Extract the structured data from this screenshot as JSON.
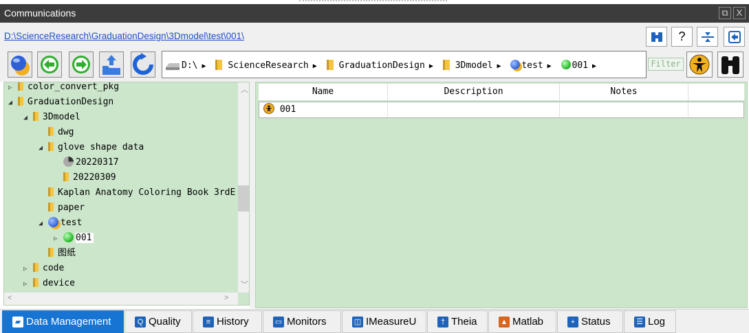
{
  "window": {
    "title": "Communications",
    "restore_glyph": "⧉",
    "close_glyph": "X"
  },
  "pathbar": {
    "path": "D:\\ScienceResearch\\GraduationDesign\\3Dmodel\\test\\001\\",
    "help_label": "?"
  },
  "breadcrumbs": [
    {
      "label": "D:\\",
      "icon": "drive-icon"
    },
    {
      "label": "ScienceResearch",
      "icon": "folder-icon"
    },
    {
      "label": "GraduationDesign",
      "icon": "folder-icon"
    },
    {
      "label": "3Dmodel",
      "icon": "folder-icon"
    },
    {
      "label": "test",
      "icon": "blue-subject-icon"
    },
    {
      "label": "001",
      "icon": "green-session-icon"
    }
  ],
  "filter_label": "Filter",
  "tree": [
    {
      "label": "color_convert_pkg",
      "indent": 0,
      "expander": "closed",
      "icon": "folder"
    },
    {
      "label": "GraduationDesign",
      "indent": 0,
      "expander": "open",
      "icon": "folder"
    },
    {
      "label": "3Dmodel",
      "indent": 1,
      "expander": "open",
      "icon": "folder"
    },
    {
      "label": "dwg",
      "indent": 2,
      "expander": "none",
      "icon": "folder"
    },
    {
      "label": "glove shape data",
      "indent": 2,
      "expander": "open",
      "icon": "folder"
    },
    {
      "label": "20220317",
      "indent": 3,
      "expander": "none",
      "icon": "pie"
    },
    {
      "label": "20220309",
      "indent": 3,
      "expander": "none",
      "icon": "folder"
    },
    {
      "label": "Kaplan Anatomy Coloring Book 3rdE",
      "indent": 2,
      "expander": "none",
      "icon": "folder"
    },
    {
      "label": "paper",
      "indent": 2,
      "expander": "none",
      "icon": "folder"
    },
    {
      "label": "test",
      "indent": 2,
      "expander": "open",
      "icon": "blue"
    },
    {
      "label": "001",
      "indent": 3,
      "expander": "closed",
      "icon": "green",
      "selected": true
    },
    {
      "label": "图纸",
      "indent": 2,
      "expander": "none",
      "icon": "folder"
    },
    {
      "label": "code",
      "indent": 1,
      "expander": "closed",
      "icon": "folder"
    },
    {
      "label": "device",
      "indent": 1,
      "expander": "closed",
      "icon": "folder"
    }
  ],
  "table": {
    "columns": [
      "Name",
      "Description",
      "Notes"
    ],
    "rows": [
      {
        "name": "001",
        "description": "",
        "notes": ""
      }
    ]
  },
  "tabs": [
    {
      "label": "Data Management",
      "icon": "folder-open-icon",
      "active": true
    },
    {
      "label": "Quality",
      "icon": "q-icon"
    },
    {
      "label": "History",
      "icon": "history-icon"
    },
    {
      "label": "Monitors",
      "icon": "monitor-icon"
    },
    {
      "label": "IMeasureU",
      "icon": "sensor-icon"
    },
    {
      "label": "Theia",
      "icon": "person-icon"
    },
    {
      "label": "Matlab",
      "icon": "matlab-icon"
    },
    {
      "label": "Status",
      "icon": "plus-icon"
    },
    {
      "label": "Log",
      "icon": "log-icon"
    }
  ],
  "colors": {
    "panel_green": "#cce6cc",
    "active_tab": "#1874d2",
    "title_bar": "#3c3c3c",
    "link": "#1f4fc4"
  }
}
